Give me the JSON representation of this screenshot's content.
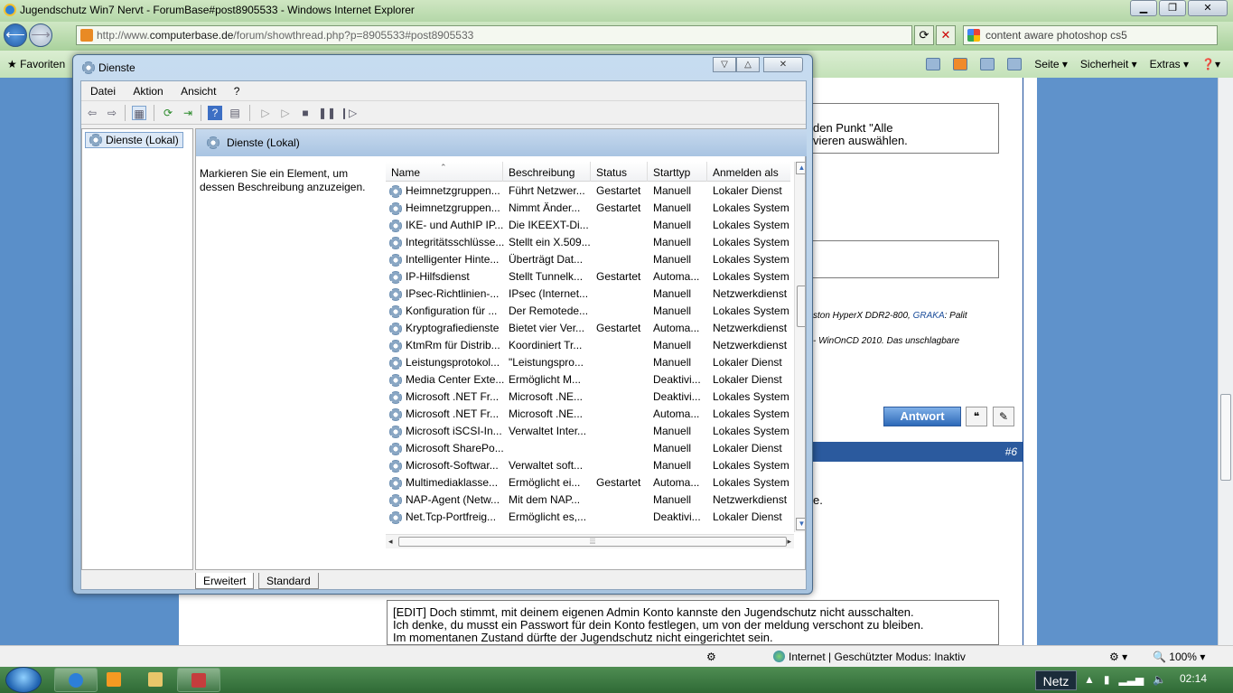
{
  "ie": {
    "title": "Jugendschutz Win7 Nervt - ForumBase#post8905533 - Windows Internet Explorer",
    "address_prefix": "http://www.",
    "address_host": "computerbase.de",
    "address_path": "/forum/showthread.php?p=8905533#post8905533",
    "search_text": "content aware photoshop cs5",
    "favorites_label": "Favoriten",
    "cmd": {
      "page": "Seite",
      "security": "Sicherheit",
      "extras": "Extras"
    },
    "status_zone": "Internet | Geschützter Modus: Inaktiv",
    "zoom": "100%"
  },
  "page": {
    "snippet_line1": "den Punkt \"Alle",
    "snippet_line2": "vieren auswählen.",
    "spec_line1_a": "ston HyperX DDR2-800, ",
    "spec_line1_b": "GRAKA",
    "spec_line1_c": ": Palit",
    "spec_line2": "- WinOnCD 2010. Das unschlagbare",
    "answer_button": "Antwort",
    "post_number": "#6",
    "snippet_e": "e.",
    "edit_line1": "[EDIT] Doch stimmt, mit deinem eigenen Admin Konto kannste den Jugendschutz nicht ausschalten.",
    "edit_line2": "Ich denke, du musst ein Passwort für dein Konto festlegen, um von der meldung verschont zu bleiben.",
    "edit_line3": "Im momentanen Zustand dürfte der Jugendschutz nicht eingerichtet sein."
  },
  "taskbar": {
    "netz": "Netz",
    "clock": "02:14"
  },
  "services": {
    "window_title": "Dienste",
    "menu": [
      "Datei",
      "Aktion",
      "Ansicht",
      "?"
    ],
    "tree_item": "Dienste (Lokal)",
    "panel_title": "Dienste (Lokal)",
    "description_hint": "Markieren Sie ein Element, um dessen Beschreibung anzuzeigen.",
    "columns": [
      "Name",
      "Beschreibung",
      "Status",
      "Starttyp",
      "Anmelden als"
    ],
    "tabs": [
      "Erweitert",
      "Standard"
    ],
    "rows": [
      [
        "Heimnetzgruppen...",
        "Führt Netzwer...",
        "Gestartet",
        "Manuell",
        "Lokaler Dienst"
      ],
      [
        "Heimnetzgruppen...",
        "Nimmt Änder...",
        "Gestartet",
        "Manuell",
        "Lokales System"
      ],
      [
        "IKE- und AuthIP IP...",
        "Die IKEEXT-Di...",
        "",
        "Manuell",
        "Lokales System"
      ],
      [
        "Integritätsschlüsse...",
        "Stellt ein X.509...",
        "",
        "Manuell",
        "Lokales System"
      ],
      [
        "Intelligenter Hinte...",
        "Überträgt Dat...",
        "",
        "Manuell",
        "Lokales System"
      ],
      [
        "IP-Hilfsdienst",
        "Stellt Tunnelk...",
        "Gestartet",
        "Automa...",
        "Lokales System"
      ],
      [
        "IPsec-Richtlinien-...",
        "IPsec (Internet...",
        "",
        "Manuell",
        "Netzwerkdienst"
      ],
      [
        "Konfiguration für ...",
        "Der Remotede...",
        "",
        "Manuell",
        "Lokales System"
      ],
      [
        "Kryptografiedienste",
        "Bietet vier Ver...",
        "Gestartet",
        "Automa...",
        "Netzwerkdienst"
      ],
      [
        "KtmRm für Distrib...",
        "Koordiniert Tr...",
        "",
        "Manuell",
        "Netzwerkdienst"
      ],
      [
        "Leistungsprotokol...",
        "\"Leistungspro...",
        "",
        "Manuell",
        "Lokaler Dienst"
      ],
      [
        "Media Center Exte...",
        "Ermöglicht M...",
        "",
        "Deaktivi...",
        "Lokaler Dienst"
      ],
      [
        "Microsoft .NET Fr...",
        "Microsoft .NE...",
        "",
        "Deaktivi...",
        "Lokales System"
      ],
      [
        "Microsoft .NET Fr...",
        "Microsoft .NE...",
        "",
        "Automa...",
        "Lokales System"
      ],
      [
        "Microsoft iSCSI-In...",
        "Verwaltet Inter...",
        "",
        "Manuell",
        "Lokales System"
      ],
      [
        "Microsoft SharePo...",
        "",
        "",
        "Manuell",
        "Lokaler Dienst"
      ],
      [
        "Microsoft-Softwar...",
        "Verwaltet soft...",
        "",
        "Manuell",
        "Lokales System"
      ],
      [
        "Multimediaklasse...",
        "Ermöglicht ei...",
        "Gestartet",
        "Automa...",
        "Lokales System"
      ],
      [
        "NAP-Agent (Netw...",
        "Mit dem NAP...",
        "",
        "Manuell",
        "Netzwerkdienst"
      ],
      [
        "Net.Tcp-Portfreig...",
        "Ermöglicht es,...",
        "",
        "Deaktivi...",
        "Lokaler Dienst"
      ]
    ]
  }
}
